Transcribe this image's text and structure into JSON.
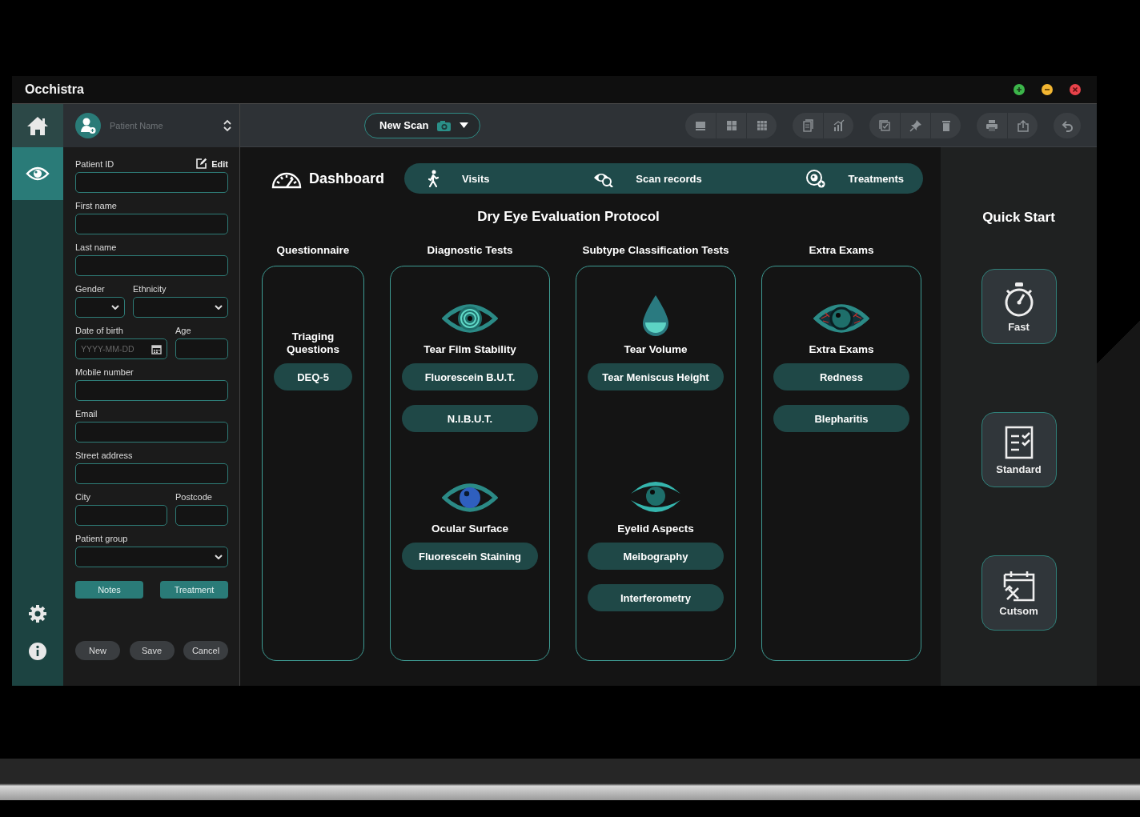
{
  "window": {
    "title": "Occhistra",
    "controls": [
      {
        "kind": "maximize",
        "color": "#3cb54a"
      },
      {
        "kind": "minimize",
        "color": "#f2b632"
      },
      {
        "kind": "close",
        "color": "#e8424a"
      }
    ]
  },
  "rail": {
    "items": [
      {
        "kind": "home",
        "selected": false
      },
      {
        "kind": "eye",
        "selected": true
      }
    ],
    "footer": [
      {
        "kind": "settings"
      },
      {
        "kind": "info"
      }
    ]
  },
  "patient_form": {
    "selector_placeholder": "Patient Name",
    "edit": "Edit",
    "rows": [
      {
        "fields": [
          {
            "kind": "text",
            "label": "Patient ID"
          }
        ]
      },
      {
        "fields": [
          {
            "kind": "text",
            "label": "First name"
          }
        ]
      },
      {
        "fields": [
          {
            "kind": "text",
            "label": "Last name"
          }
        ]
      },
      {
        "fields": [
          {
            "kind": "select",
            "label": "Gender"
          },
          {
            "kind": "select",
            "label": "Ethnicity"
          }
        ]
      },
      {
        "fields": [
          {
            "kind": "date",
            "label": "Date of birth",
            "placeholder": "YYYY-MM-DD"
          },
          {
            "kind": "text",
            "label": "Age"
          }
        ]
      },
      {
        "fields": [
          {
            "kind": "text",
            "label": "Mobile number"
          }
        ]
      },
      {
        "fields": [
          {
            "kind": "text",
            "label": "Email"
          }
        ]
      },
      {
        "fields": [
          {
            "kind": "text",
            "label": "Street address"
          }
        ]
      },
      {
        "fields": [
          {
            "kind": "text",
            "label": "City"
          },
          {
            "kind": "text",
            "label": "Postcode"
          }
        ]
      },
      {
        "fields": [
          {
            "kind": "select",
            "label": "Patient group"
          }
        ]
      }
    ],
    "actions": [
      "Notes",
      "Treatment"
    ],
    "buttons": [
      "New",
      "Save",
      "Cancel"
    ]
  },
  "toolbar": {
    "new_scan": "New Scan"
  },
  "dashboard": {
    "title": "Dashboard",
    "nav": [
      {
        "kind": "visits",
        "label": "Visits",
        "selected": false
      },
      {
        "kind": "scans",
        "label": "Scan records",
        "selected": false
      },
      {
        "kind": "treatments",
        "label": "Treatments",
        "selected": false
      }
    ],
    "protocol": "Dry Eye Evaluation Protocol",
    "columns": [
      {
        "heading": "Questionnaire",
        "sections": [
          {
            "kind": "none",
            "title": "Triaging Questions",
            "tests": [
              "DEQ-5"
            ]
          }
        ]
      },
      {
        "heading": "Diagnostic Tests",
        "sections": [
          {
            "kind": "target-eye",
            "title": "Tear Film Stability",
            "tests": [
              "Fluorescein B.U.T.",
              "N.I.B.U.T."
            ]
          },
          {
            "kind": "blue-eye",
            "title": "Ocular Surface",
            "tests": [
              "Fluorescein Staining"
            ]
          }
        ]
      },
      {
        "heading": "Subtype Classification Tests",
        "sections": [
          {
            "kind": "drop",
            "title": "Tear Volume",
            "tests": [
              "Tear Meniscus Height"
            ]
          },
          {
            "kind": "lid-eye",
            "title": "Eyelid Aspects",
            "tests": [
              "Meibography",
              "Interferometry"
            ]
          }
        ]
      },
      {
        "heading": "Extra Exams",
        "sections": [
          {
            "kind": "red-eye",
            "title": "Extra Exams",
            "tests": [
              "Redness",
              "Blepharitis"
            ]
          }
        ]
      }
    ]
  },
  "quick_start": {
    "title": "Quick Start",
    "items": [
      {
        "kind": "fast",
        "label": "Fast"
      },
      {
        "kind": "standard",
        "label": "Standard"
      },
      {
        "kind": "custom",
        "label": "Cutsom"
      }
    ]
  }
}
